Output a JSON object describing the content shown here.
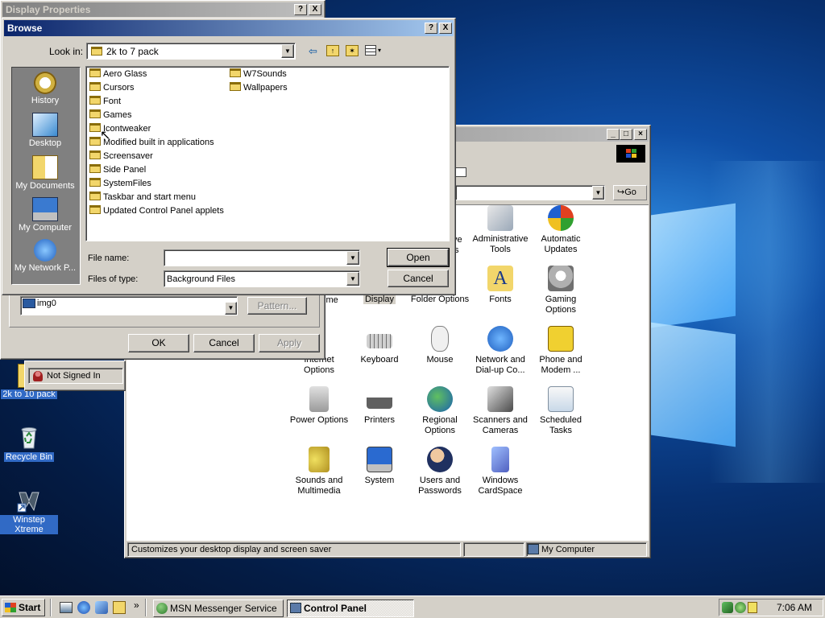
{
  "desktop": {
    "icons": [
      {
        "label": "2k to 10 pack"
      },
      {
        "label": "Recycle Bin"
      },
      {
        "label": "Winstep Xtreme"
      }
    ]
  },
  "display_properties": {
    "title": "Display Properties",
    "help_btn": "?",
    "close_btn": "X",
    "wallpaper_value": "img0",
    "pattern_button": "Pattern...",
    "ok_button": "OK",
    "cancel_button": "Cancel",
    "apply_button": "Apply"
  },
  "msn_popup": {
    "status": "Not Signed In"
  },
  "browse": {
    "title": "Browse",
    "help_btn": "?",
    "close_btn": "X",
    "look_in_label": "Look in:",
    "look_in_value": "2k to 7 pack",
    "places": [
      {
        "label": "History"
      },
      {
        "label": "Desktop"
      },
      {
        "label": "My Documents"
      },
      {
        "label": "My Computer"
      },
      {
        "label": "My Network P..."
      }
    ],
    "folders_col1": [
      "Aero Glass",
      "Cursors",
      "Font",
      "Games",
      "Icontweaker",
      "Modified built in applications",
      "Screensaver",
      "Side Panel",
      "SystemFiles",
      "Taskbar and start menu",
      "Updated Control Panel applets"
    ],
    "folders_col2": [
      "W7Sounds",
      "Wallpapers"
    ],
    "file_name_label": "File name:",
    "file_name_value": "",
    "file_type_label": "Files of type:",
    "file_type_value": "Background Files",
    "open_button": "Open",
    "cancel_button": "Cancel"
  },
  "control_panel": {
    "go_button": "Go",
    "items": [
      {
        "label": "Administrative Tools"
      },
      {
        "label": "Automatic Updates"
      },
      {
        "label": "Display"
      },
      {
        "label": "Folder Options"
      },
      {
        "label": "Fonts"
      },
      {
        "label": "Gaming Options"
      },
      {
        "label": "Internet Options"
      },
      {
        "label": "Keyboard"
      },
      {
        "label": "Mouse"
      },
      {
        "label": "Network and Dial-up Co..."
      },
      {
        "label": "Phone and Modem ..."
      },
      {
        "label": "Power Options"
      },
      {
        "label": "Printers"
      },
      {
        "label": "Regional Options"
      },
      {
        "label": "Scanners and Cameras"
      },
      {
        "label": "Scheduled Tasks"
      },
      {
        "label": "Sounds and Multimedia"
      },
      {
        "label": "System"
      },
      {
        "label": "Users and Passwords"
      },
      {
        "label": "Windows CardSpace"
      }
    ],
    "partial_labels": {
      "ve": "ve",
      "s": "s",
      "ime": "ime"
    },
    "status_text": "Customizes your desktop display and screen saver",
    "status_location": "My Computer"
  },
  "taskbar": {
    "start_label": "Start",
    "tasks": [
      {
        "label": "MSN Messenger Service"
      },
      {
        "label": "Control Panel"
      }
    ],
    "chevron": "»",
    "clock": "7:06 AM"
  }
}
